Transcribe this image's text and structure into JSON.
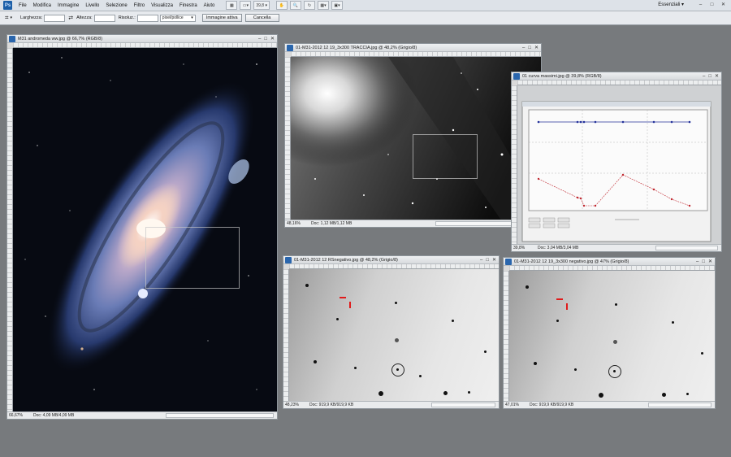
{
  "menubar": {
    "logo": "Ps",
    "items": [
      "File",
      "Modifica",
      "Immagine",
      "Livello",
      "Selezione",
      "Filtro",
      "Visualizza",
      "Finestra",
      "Aiuto"
    ],
    "zoom_value": "39,8",
    "workspace": "Essenziali",
    "window_controls": [
      "–",
      "□",
      "✕"
    ]
  },
  "optionsbar": {
    "width_label": "Larghezza:",
    "height_label": "Altezza:",
    "resolution_label": "Risoluz.:",
    "unit_value": "pixel/pollice",
    "front_image_button": "Immagine attiva",
    "clear_button": "Cancella"
  },
  "windows": {
    "andromeda": {
      "title": "M31 andromeda ww.jpg @ 66,7% (RGB/8)",
      "zoom": "66,67%",
      "doc": "Doc: 4,09 MB/4,09 MB"
    },
    "traccia": {
      "title": "01-M31-2012 12 19_3x300 TRACCIA.jpg @ 48,2% (Grigio/8)",
      "zoom": "48,16%",
      "doc": "Doc: 1,12 MB/1,12 MB"
    },
    "curva": {
      "title": "01 curva massimi.jpg @ 39,8% (RGB/8)",
      "zoom": "39,8%",
      "doc": "Doc: 3,04 MB/3,04 MB"
    },
    "rsnegativo": {
      "title": "01-M31-2012 12 RSnegativo.jpg @ 48,2% (Grigio/8)",
      "zoom": "48,23%",
      "doc": "Doc: 919,9 KB/919,9 KB"
    },
    "negativo": {
      "title": "01-M31-2012 12 19_3x300 negativo.jpg @ 47% (Grigio/8)",
      "zoom": "47,01%",
      "doc": "Doc: 919,9 KB/919,9 KB"
    }
  },
  "icons": {
    "crop_tool": "crop-icon",
    "hand_tool": "hand-icon",
    "zoom_tool": "zoom-icon",
    "rotate_view": "rotate-view-icon"
  },
  "colors": {
    "accent": "#1c5fa8",
    "marker": "#e01b1b",
    "curve_blue": "#23309a",
    "curve_red": "#c0262e"
  }
}
